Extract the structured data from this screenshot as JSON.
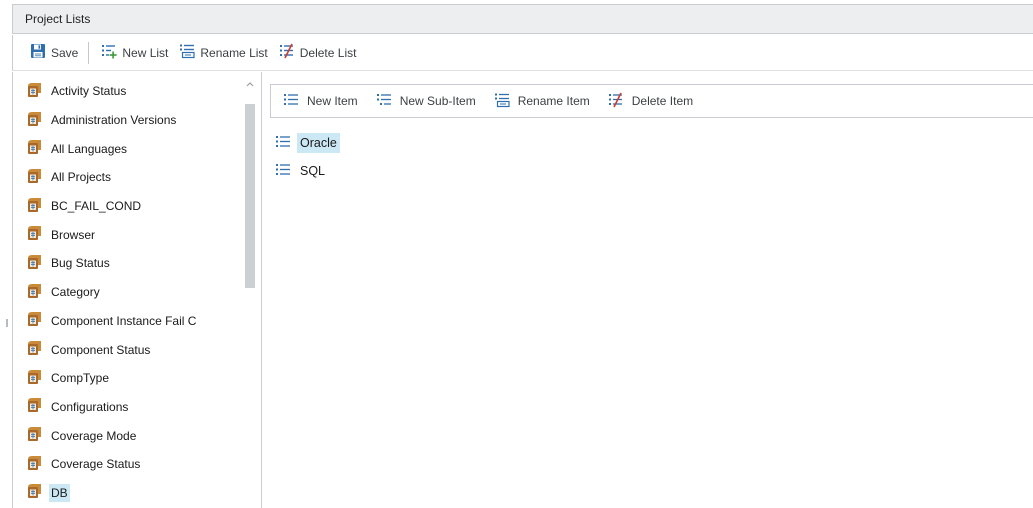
{
  "panel": {
    "title": "Project Lists"
  },
  "main_toolbar": {
    "save_label": "Save",
    "new_list_label": "New List",
    "rename_list_label": "Rename List",
    "delete_list_label": "Delete List"
  },
  "lists": [
    {
      "label": "Activity Status"
    },
    {
      "label": "Administration Versions"
    },
    {
      "label": "All Languages"
    },
    {
      "label": "All Projects"
    },
    {
      "label": "BC_FAIL_COND"
    },
    {
      "label": "Browser"
    },
    {
      "label": "Bug Status"
    },
    {
      "label": "Category"
    },
    {
      "label": "Component Instance Fail C"
    },
    {
      "label": "Component Status"
    },
    {
      "label": "CompType"
    },
    {
      "label": "Configurations"
    },
    {
      "label": "Coverage Mode"
    },
    {
      "label": "Coverage Status"
    },
    {
      "label": "DB"
    }
  ],
  "selected_list": "DB",
  "item_toolbar": {
    "new_item_label": "New Item",
    "new_subitem_label": "New Sub-Item",
    "rename_item_label": "Rename Item",
    "delete_item_label": "Delete Item"
  },
  "items": [
    {
      "label": "Oracle"
    },
    {
      "label": "SQL"
    }
  ],
  "selected_item": "Oracle",
  "colors": {
    "selection": "#cce8f4",
    "icon_blue": "#2f6fb0",
    "list_icon_brown": "#b77a2f",
    "delete_red": "#d23b2f"
  }
}
